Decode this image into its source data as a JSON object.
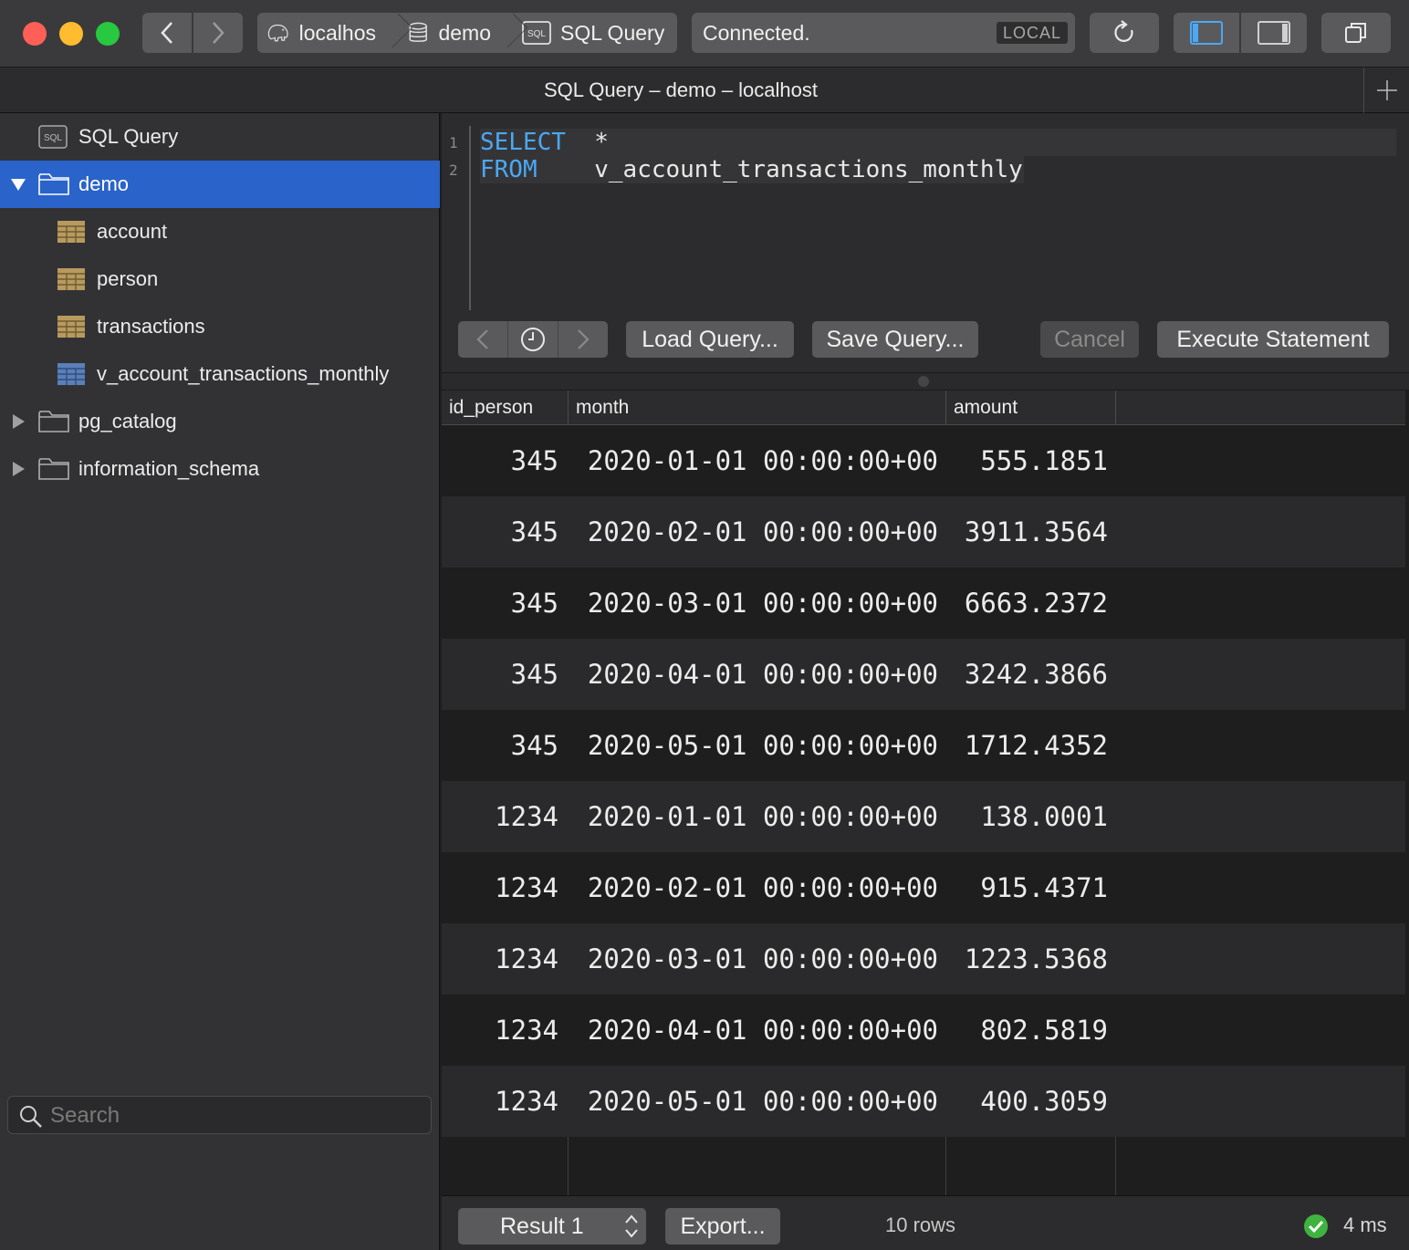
{
  "toolbar": {
    "breadcrumbs": [
      "localhos",
      "demo",
      "SQL Query"
    ],
    "status_text": "Connected.",
    "badge": "LOCAL"
  },
  "window": {
    "title": "SQL Query – demo – localhost"
  },
  "sidebar": {
    "items": [
      {
        "label": "SQL Query",
        "icon": "sql-icon"
      },
      {
        "label": "demo",
        "icon": "folder-icon",
        "expanded": true,
        "selected": true
      },
      {
        "label": "account",
        "icon": "table-icon"
      },
      {
        "label": "person",
        "icon": "table-icon"
      },
      {
        "label": "transactions",
        "icon": "table-icon"
      },
      {
        "label": "v_account_transactions_monthly",
        "icon": "view-icon"
      },
      {
        "label": "pg_catalog",
        "icon": "folder-icon",
        "expanded": false
      },
      {
        "label": "information_schema",
        "icon": "folder-icon",
        "expanded": false
      }
    ],
    "search_placeholder": "Search"
  },
  "editor": {
    "lines": [
      {
        "num": "1",
        "keyword": "SELECT",
        "rest": "  *"
      },
      {
        "num": "2",
        "keyword": "FROM",
        "rest": "    v_account_transactions_monthly"
      }
    ],
    "buttons": {
      "load": "Load Query...",
      "save": "Save Query...",
      "cancel": "Cancel",
      "execute": "Execute Statement"
    }
  },
  "results": {
    "columns": [
      "id_person",
      "month",
      "amount"
    ],
    "rows": [
      [
        "345",
        "2020-01-01 00:00:00+00",
        "555.1851"
      ],
      [
        "345",
        "2020-02-01 00:00:00+00",
        "3911.3564"
      ],
      [
        "345",
        "2020-03-01 00:00:00+00",
        "6663.2372"
      ],
      [
        "345",
        "2020-04-01 00:00:00+00",
        "3242.3866"
      ],
      [
        "345",
        "2020-05-01 00:00:00+00",
        "1712.4352"
      ],
      [
        "1234",
        "2020-01-01 00:00:00+00",
        "138.0001"
      ],
      [
        "1234",
        "2020-02-01 00:00:00+00",
        "915.4371"
      ],
      [
        "1234",
        "2020-03-01 00:00:00+00",
        "1223.5368"
      ],
      [
        "1234",
        "2020-04-01 00:00:00+00",
        "802.5819"
      ],
      [
        "1234",
        "2020-05-01 00:00:00+00",
        "400.3059"
      ]
    ]
  },
  "footer": {
    "result_label": "Result 1",
    "export_label": "Export...",
    "row_count": "10 rows",
    "timing": "4 ms"
  },
  "colors": {
    "accent": "#2a63c9",
    "keyword": "#4ba8f5",
    "success": "#3fb33f"
  }
}
